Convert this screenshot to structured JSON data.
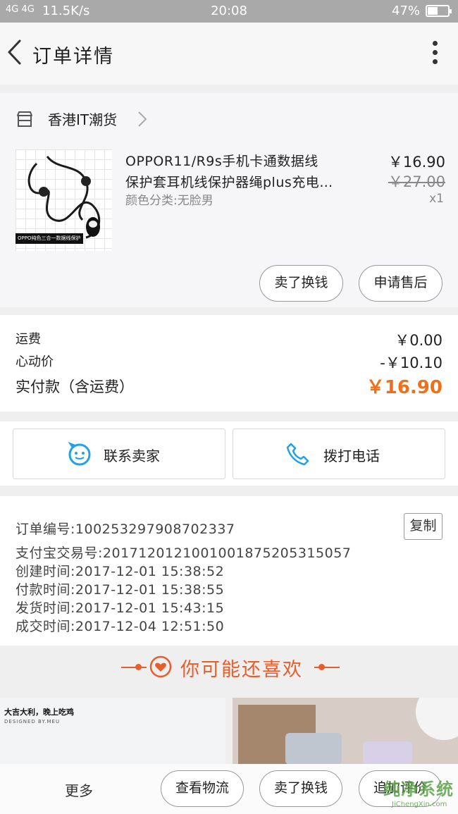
{
  "status_bar": {
    "signal": "4G 4G",
    "speed": "11.5K/s",
    "time": "20:08",
    "battery": "47%",
    "battery_level": 0.47
  },
  "header": {
    "title": "订单详情"
  },
  "shop": {
    "name": "香港IT潮货"
  },
  "product": {
    "title_line1": "OPPOR11/R9s手机卡通数据线",
    "title_line2": "保护套耳机线保护器绳plus充电…",
    "variant": "颜色分类:无脸男",
    "price": "￥16.90",
    "original_price": "￥27.00",
    "quantity": "x1",
    "image_caption": "OPPO纯色三合一数据线保护",
    "actions": {
      "sell_label": "卖了换钱",
      "after_sale_label": "申请售后"
    }
  },
  "fees": {
    "shipping_label": "运费",
    "shipping_value": "￥0.00",
    "discount_label": "心动价",
    "discount_value": "-￥10.10",
    "total_label": "实付款（含运费）",
    "total_value": "￥16.90"
  },
  "contact": {
    "seller_label": "联系卖家",
    "call_label": "拨打电话"
  },
  "order_info": {
    "order_no": "订单编号:100253297908702337",
    "alipay_no": "支付宝交易号:2017120121001001875205315057",
    "created": "创建时间:2017-12-01  15:38:52",
    "paid": "付款时间:2017-12-01  15:38:55",
    "shipped": "发货时间:2017-12-01  15:43:15",
    "completed": "成交时间:2017-12-04  12:51:50",
    "copy_label": "复制"
  },
  "recommend": {
    "title": "你可能还喜欢",
    "item1_title": "大吉大利，晚上吃鸡",
    "item1_sub": "DESIGNED BY.MEU"
  },
  "bottom_bar": {
    "more": "更多",
    "logistics": "查看物流",
    "sell": "卖了换钱",
    "review": "追加评价"
  },
  "watermark": {
    "cn": "纯净系统",
    "en": "JiChengXin.com"
  },
  "colors": {
    "accent": "#f26f1a",
    "recommend": "#e85e2b",
    "contact_icon": "#1fa2e8"
  }
}
